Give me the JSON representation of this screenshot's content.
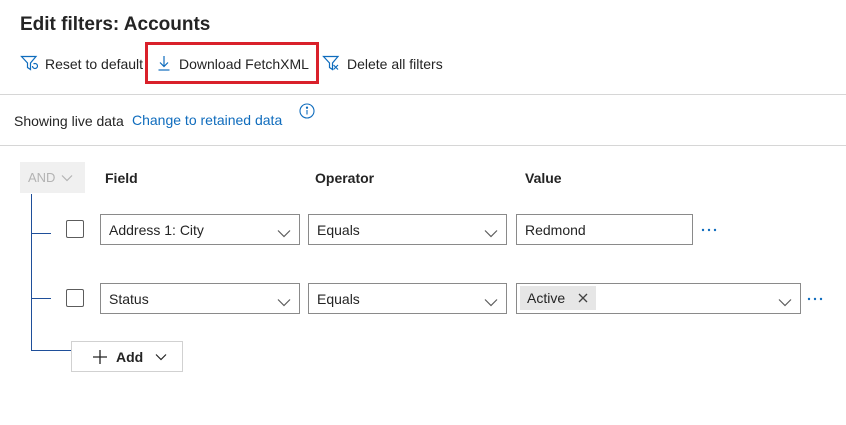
{
  "page": {
    "title": "Edit filters: Accounts"
  },
  "toolbar": {
    "reset_label": "Reset to default",
    "download_label": "Download FetchXML",
    "delete_label": "Delete all filters"
  },
  "data_source": {
    "label": "Showing live data",
    "link": "Change to retained data"
  },
  "filter_group": {
    "operator": "AND",
    "headers": {
      "field": "Field",
      "operator": "Operator",
      "value": "Value"
    },
    "rows": [
      {
        "field": "Address 1: City",
        "operator": "Equals",
        "value": "Redmond"
      },
      {
        "field": "Status",
        "operator": "Equals",
        "value_tag": "Active"
      }
    ],
    "add_label": "Add"
  },
  "colors": {
    "accent": "#0f6cbd",
    "highlight": "#d9202a",
    "tree_line": "#1f4f9a"
  },
  "icons": [
    "filter-reset-icon",
    "download-icon",
    "filter-delete-icon",
    "info-icon",
    "chevron-down-icon",
    "more-icon",
    "close-icon",
    "plus-icon"
  ]
}
